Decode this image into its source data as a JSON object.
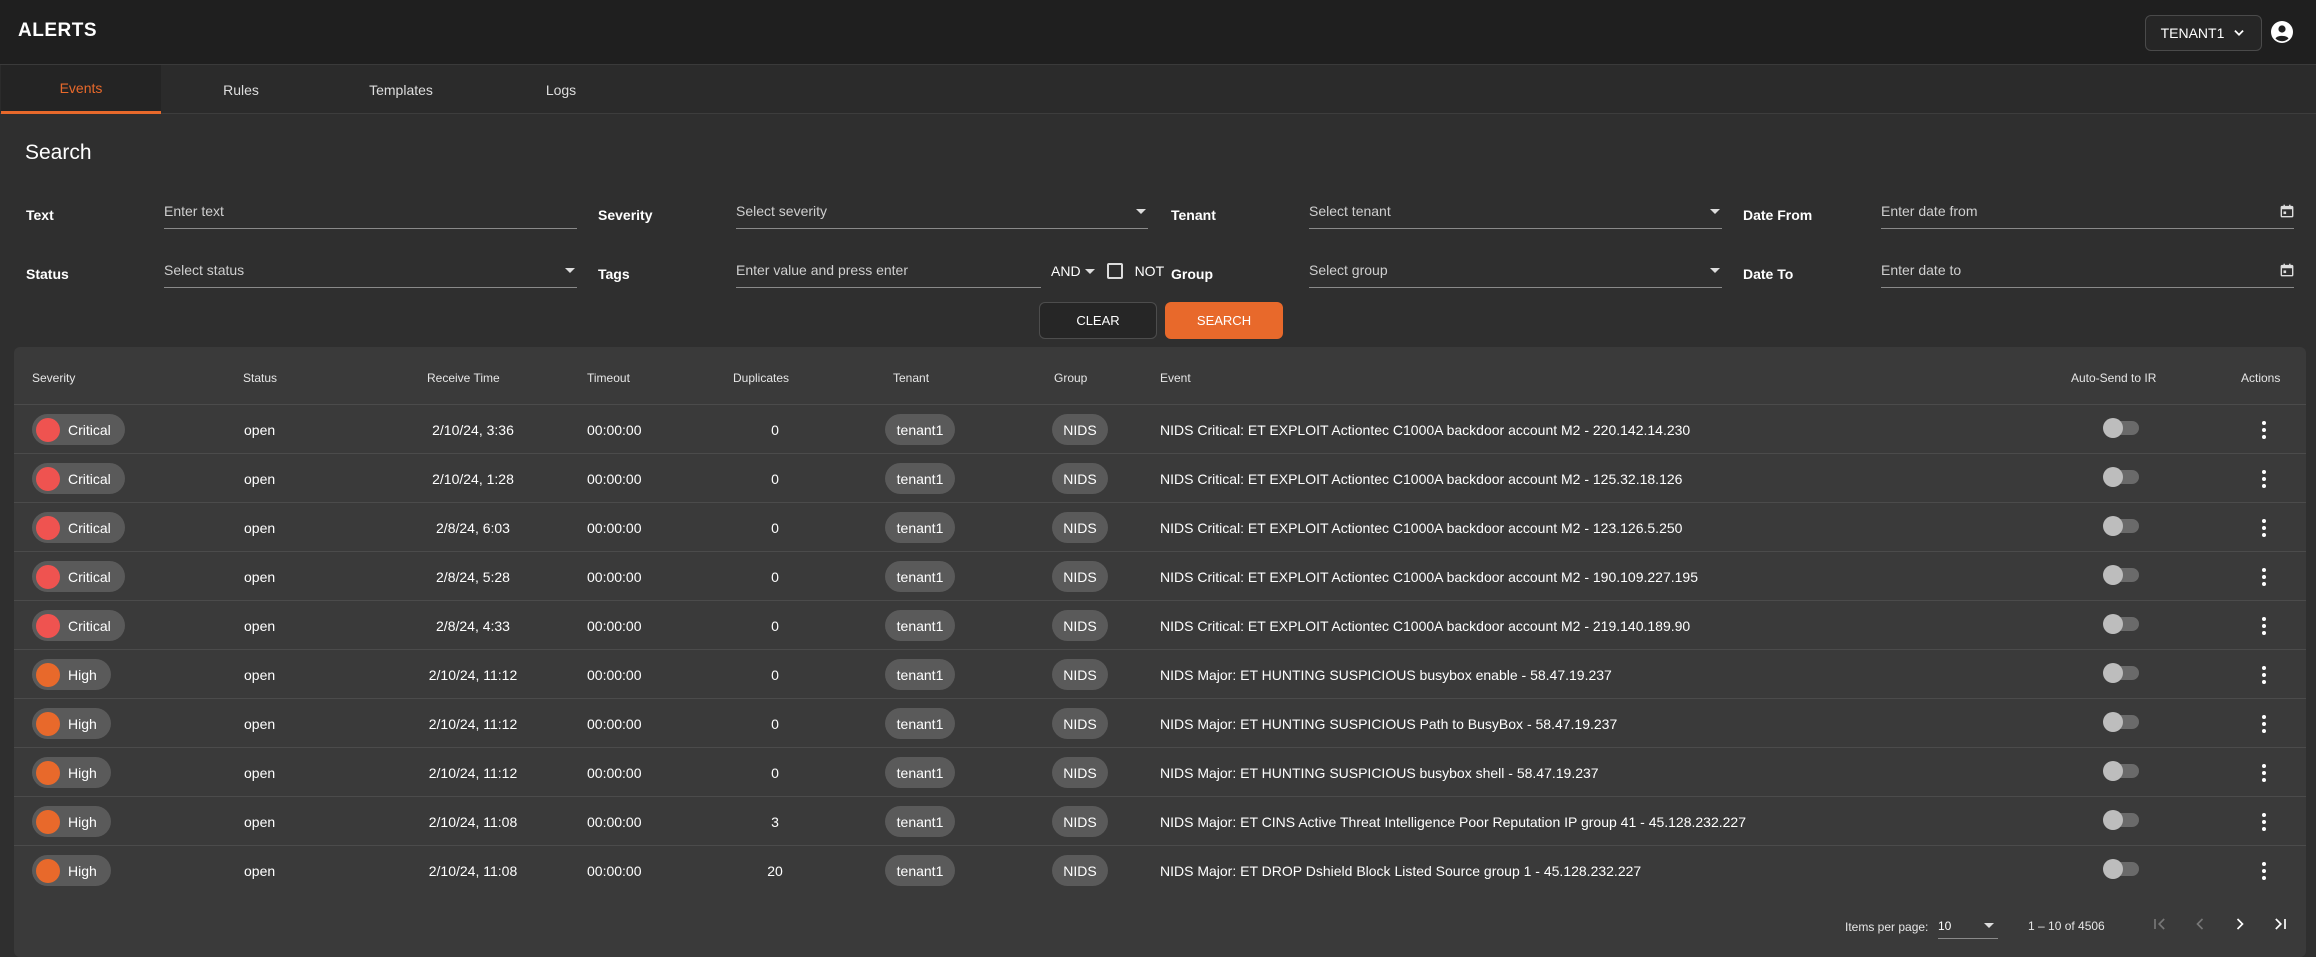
{
  "header": {
    "title": "ALERTS",
    "tenant_label": "TENANT1"
  },
  "tabs": [
    {
      "label": "Events",
      "active": true
    },
    {
      "label": "Rules",
      "active": false
    },
    {
      "label": "Templates",
      "active": false
    },
    {
      "label": "Logs",
      "active": false
    }
  ],
  "search": {
    "title": "Search",
    "text_label": "Text",
    "text_placeholder": "Enter text",
    "severity_label": "Severity",
    "severity_placeholder": "Select severity",
    "tenant_label": "Tenant",
    "tenant_placeholder": "Select tenant",
    "date_from_label": "Date From",
    "date_from_placeholder": "Enter date from",
    "status_label": "Status",
    "status_placeholder": "Select status",
    "tags_label": "Tags",
    "tags_placeholder": "Enter value and press enter",
    "and_label": "AND",
    "not_label": "NOT",
    "group_label": "Group",
    "group_placeholder": "Select group",
    "date_to_label": "Date To",
    "date_to_placeholder": "Enter date to",
    "clear_label": "CLEAR",
    "search_label": "SEARCH"
  },
  "table": {
    "headers": {
      "severity": "Severity",
      "status": "Status",
      "receive_time": "Receive Time",
      "timeout": "Timeout",
      "duplicates": "Duplicates",
      "tenant": "Tenant",
      "group": "Group",
      "event": "Event",
      "auto_send": "Auto-Send to IR",
      "actions": "Actions"
    },
    "rows": [
      {
        "severity": "Critical",
        "status": "open",
        "receive_time": "2/10/24, 3:36",
        "timeout": "00:00:00",
        "duplicates": "0",
        "tenant": "tenant1",
        "group": "NIDS",
        "event": "NIDS Critical: ET EXPLOIT Actiontec C1000A backdoor account M2 - 220.142.14.230"
      },
      {
        "severity": "Critical",
        "status": "open",
        "receive_time": "2/10/24, 1:28",
        "timeout": "00:00:00",
        "duplicates": "0",
        "tenant": "tenant1",
        "group": "NIDS",
        "event": "NIDS Critical: ET EXPLOIT Actiontec C1000A backdoor account M2 - 125.32.18.126"
      },
      {
        "severity": "Critical",
        "status": "open",
        "receive_time": "2/8/24, 6:03",
        "timeout": "00:00:00",
        "duplicates": "0",
        "tenant": "tenant1",
        "group": "NIDS",
        "event": "NIDS Critical: ET EXPLOIT Actiontec C1000A backdoor account M2 - 123.126.5.250"
      },
      {
        "severity": "Critical",
        "status": "open",
        "receive_time": "2/8/24, 5:28",
        "timeout": "00:00:00",
        "duplicates": "0",
        "tenant": "tenant1",
        "group": "NIDS",
        "event": "NIDS Critical: ET EXPLOIT Actiontec C1000A backdoor account M2 - 190.109.227.195"
      },
      {
        "severity": "Critical",
        "status": "open",
        "receive_time": "2/8/24, 4:33",
        "timeout": "00:00:00",
        "duplicates": "0",
        "tenant": "tenant1",
        "group": "NIDS",
        "event": "NIDS Critical: ET EXPLOIT Actiontec C1000A backdoor account M2 - 219.140.189.90"
      },
      {
        "severity": "High",
        "status": "open",
        "receive_time": "2/10/24, 11:12",
        "timeout": "00:00:00",
        "duplicates": "0",
        "tenant": "tenant1",
        "group": "NIDS",
        "event": "NIDS Major: ET HUNTING SUSPICIOUS busybox enable - 58.47.19.237"
      },
      {
        "severity": "High",
        "status": "open",
        "receive_time": "2/10/24, 11:12",
        "timeout": "00:00:00",
        "duplicates": "0",
        "tenant": "tenant1",
        "group": "NIDS",
        "event": "NIDS Major: ET HUNTING SUSPICIOUS Path to BusyBox - 58.47.19.237"
      },
      {
        "severity": "High",
        "status": "open",
        "receive_time": "2/10/24, 11:12",
        "timeout": "00:00:00",
        "duplicates": "0",
        "tenant": "tenant1",
        "group": "NIDS",
        "event": "NIDS Major: ET HUNTING SUSPICIOUS busybox shell - 58.47.19.237"
      },
      {
        "severity": "High",
        "status": "open",
        "receive_time": "2/10/24, 11:08",
        "timeout": "00:00:00",
        "duplicates": "3",
        "tenant": "tenant1",
        "group": "NIDS",
        "event": "NIDS Major: ET CINS Active Threat Intelligence Poor Reputation IP group 41 - 45.128.232.227"
      },
      {
        "severity": "High",
        "status": "open",
        "receive_time": "2/10/24, 11:08",
        "timeout": "00:00:00",
        "duplicates": "20",
        "tenant": "tenant1",
        "group": "NIDS",
        "event": "NIDS Major: ET DROP Dshield Block Listed Source group 1 - 45.128.232.227"
      }
    ]
  },
  "pagination": {
    "items_per_page_label": "Items per page:",
    "items_per_page": "10",
    "range": "1 – 10 of 4506"
  },
  "colors": {
    "accent": "#e8692b",
    "critical": "#ef5350",
    "high": "#e8692b"
  }
}
